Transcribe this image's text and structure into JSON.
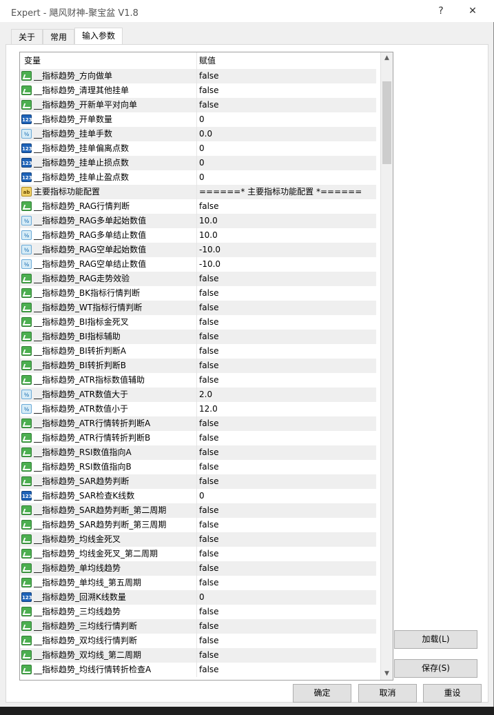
{
  "window": {
    "title": "Expert - 飓风财神-聚宝盆 V1.8",
    "help": "?",
    "close": "✕"
  },
  "tabs": [
    {
      "label": "关于"
    },
    {
      "label": "常用"
    },
    {
      "label": "输入参数"
    }
  ],
  "grid": {
    "col_variable": "变量",
    "col_value": "赋值",
    "rows": [
      {
        "type": "bool",
        "name": "__指标趋势_方向做单",
        "value": "false"
      },
      {
        "type": "bool",
        "name": "__指标趋势_清理其他挂单",
        "value": "false"
      },
      {
        "type": "bool",
        "name": "__指标趋势_开新单平对向单",
        "value": "false"
      },
      {
        "type": "int",
        "name": "__指标趋势_开单数量",
        "value": "0"
      },
      {
        "type": "dbl",
        "name": "__指标趋势_挂单手数",
        "value": "0.0"
      },
      {
        "type": "int",
        "name": "__指标趋势_挂单偏离点数",
        "value": "0"
      },
      {
        "type": "int",
        "name": "__指标趋势_挂单止损点数",
        "value": "0"
      },
      {
        "type": "int",
        "name": "__指标趋势_挂单止盈点数",
        "value": "0"
      },
      {
        "type": "str",
        "name": "主要指标功能配置",
        "value": "======* 主要指标功能配置 *======"
      },
      {
        "type": "bool",
        "name": "__指标趋势_RAG行情判断",
        "value": "false"
      },
      {
        "type": "dbl",
        "name": "__指标趋势_RAG多单起始数值",
        "value": "10.0"
      },
      {
        "type": "dbl",
        "name": "__指标趋势_RAG多单结止数值",
        "value": "10.0"
      },
      {
        "type": "dbl",
        "name": "__指标趋势_RAG空单起始数值",
        "value": "-10.0"
      },
      {
        "type": "dbl",
        "name": "__指标趋势_RAG空单结止数值",
        "value": "-10.0"
      },
      {
        "type": "bool",
        "name": "__指标趋势_RAG走势效验",
        "value": "false"
      },
      {
        "type": "bool",
        "name": "__指标趋势_BK指标行情判断",
        "value": "false"
      },
      {
        "type": "bool",
        "name": "__指标趋势_WT指标行情判断",
        "value": "false"
      },
      {
        "type": "bool",
        "name": "__指标趋势_BI指标金死叉",
        "value": "false"
      },
      {
        "type": "bool",
        "name": "__指标趋势_BI指标辅助",
        "value": "false"
      },
      {
        "type": "bool",
        "name": "__指标趋势_BI转折判断A",
        "value": "false"
      },
      {
        "type": "bool",
        "name": "__指标趋势_BI转折判断B",
        "value": "false"
      },
      {
        "type": "bool",
        "name": "__指标趋势_ATR指标数值辅助",
        "value": "false"
      },
      {
        "type": "dbl",
        "name": "__指标趋势_ATR数值大于",
        "value": "2.0"
      },
      {
        "type": "dbl",
        "name": "__指标趋势_ATR数值小于",
        "value": "12.0"
      },
      {
        "type": "bool",
        "name": "__指标趋势_ATR行情转折判断A",
        "value": "false"
      },
      {
        "type": "bool",
        "name": "__指标趋势_ATR行情转折判断B",
        "value": "false"
      },
      {
        "type": "bool",
        "name": "__指标趋势_RSI数值指向A",
        "value": "false"
      },
      {
        "type": "bool",
        "name": "__指标趋势_RSI数值指向B",
        "value": "false"
      },
      {
        "type": "bool",
        "name": "__指标趋势_SAR趋势判断",
        "value": "false"
      },
      {
        "type": "int",
        "name": "__指标趋势_SAR检查K线数",
        "value": "0"
      },
      {
        "type": "bool",
        "name": "__指标趋势_SAR趋势判断_第二周期",
        "value": "false"
      },
      {
        "type": "bool",
        "name": "__指标趋势_SAR趋势判断_第三周期",
        "value": "false"
      },
      {
        "type": "bool",
        "name": "__指标趋势_均线金死叉",
        "value": "false"
      },
      {
        "type": "bool",
        "name": "__指标趋势_均线金死叉_第二周期",
        "value": "false"
      },
      {
        "type": "bool",
        "name": "__指标趋势_单均线趋势",
        "value": "false"
      },
      {
        "type": "bool",
        "name": "__指标趋势_单均线_第五周期",
        "value": "false"
      },
      {
        "type": "int",
        "name": "__指标趋势_回溯K线数量",
        "value": "0"
      },
      {
        "type": "bool",
        "name": "__指标趋势_三均线趋势",
        "value": "false"
      },
      {
        "type": "bool",
        "name": "__指标趋势_三均线行情判断",
        "value": "false"
      },
      {
        "type": "bool",
        "name": "__指标趋势_双均线行情判断",
        "value": "false"
      },
      {
        "type": "bool",
        "name": "__指标趋势_双均线_第二周期",
        "value": "false"
      },
      {
        "type": "bool",
        "name": "__指标趋势_均线行情转折检查A",
        "value": "false"
      }
    ]
  },
  "icons": {
    "bool": "checkmark-icon",
    "int": "integer-123-icon",
    "dbl": "double-half-icon",
    "str": "string-ab-icon"
  },
  "buttons": {
    "load": "加载(L)",
    "save": "保存(S)",
    "ok": "确定",
    "cancel": "取消",
    "reset": "重设"
  },
  "colors": {
    "bool_icon": "#4caf50",
    "int_icon": "#1e63b8",
    "dbl_icon": "#d6ecf7",
    "str_icon": "#f1d36a"
  }
}
